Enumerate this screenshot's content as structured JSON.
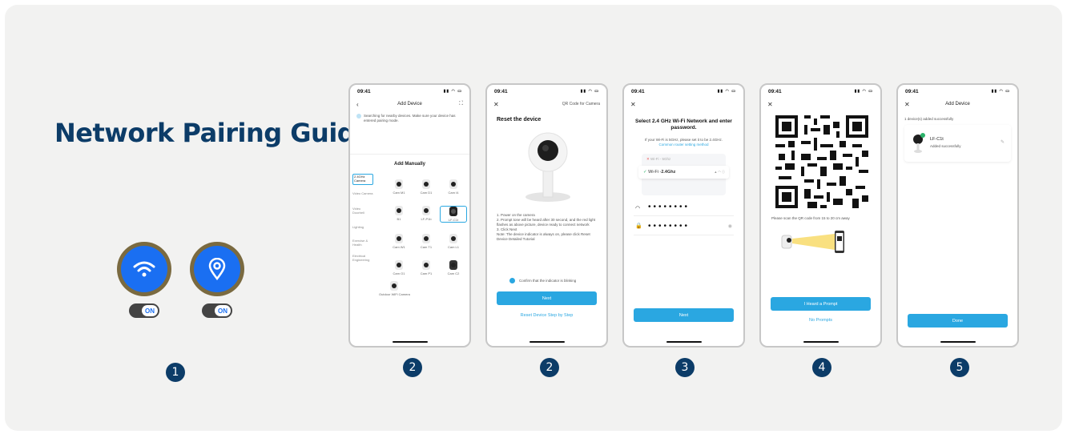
{
  "title": "Network Pairing Guide",
  "step_badges": [
    "1",
    "2",
    "2",
    "3",
    "4",
    "5"
  ],
  "toggles": {
    "wifi_label": "ON",
    "location_label": "ON"
  },
  "status": {
    "time": "09:41"
  },
  "screen1": {
    "header": "Add Device",
    "notice": "Searching for nearby devices. Make sure your device has entered pairing mode.",
    "section": "Add Manually",
    "categories": [
      "2.4GHz Camera",
      "Video Camera",
      "Video Doorbell",
      "Lighting",
      "Exercise & Health",
      "Electrical Engineering"
    ],
    "devices": [
      "Cam M1",
      "Cam D1",
      "Cam I4",
      "B1",
      "LF-P1b",
      "LF-C1t",
      "Cam W1",
      "Cam T1",
      "Cam L1",
      "Cam O1",
      "Cam P1",
      "Cam C2"
    ],
    "outdoor": "Outdoor WiFi Camera"
  },
  "screen2": {
    "header": "QR Code for Camera",
    "heading": "Reset the device",
    "steps": [
      "1. Power on the camera",
      "2. Prompt tone will be heard after 30 second, and the red light flashes as above picture, device ready to connect network",
      "3. Click Next",
      "Note: The device indicator is always on, please click Reset Device Detailed Tutorial"
    ],
    "confirm": "Confirm that the indicator is blinking",
    "next": "Next",
    "link": "Reset Device Step by Step"
  },
  "screen3": {
    "heading": "Select 2.4 GHz Wi-Fi Network and enter password.",
    "sub": "If your Wi-Fi is 5GHz, please set it to be 2.4GHz.",
    "sublink": "Common router setting method",
    "wifi_5g": "Wi-Fi - 5Ghz",
    "wifi_24g_prefix": "Wi-Fi - ",
    "wifi_24g_band": "2.4Ghz",
    "ssid_mask": "••••••••",
    "pwd_mask": "••••••••",
    "next": "Next"
  },
  "screen4": {
    "hint": "Please scan the QR code from 15 to 20 cm away",
    "heard": "I Heard a Prompt",
    "no_prompt": "No Prompts"
  },
  "screen5": {
    "header": "Add Device",
    "count": "1 device(s) added successfully",
    "device_name": "LF-C1t",
    "device_status": "Added successfully",
    "done": "Done"
  }
}
